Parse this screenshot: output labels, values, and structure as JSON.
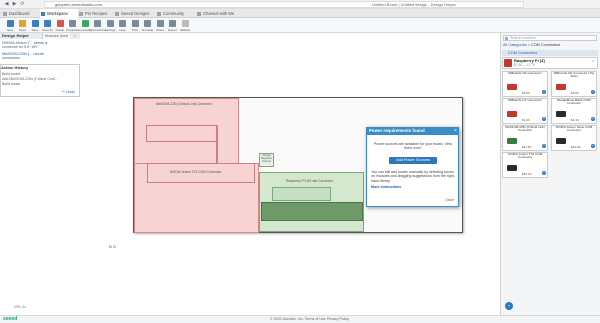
{
  "browser": {
    "url": "geppetto.seeedstudio.com",
    "center_title": "Untitled Board | Untitled design - Design Helper",
    "controls": [
      "←",
      "→",
      "⟳"
    ]
  },
  "tabs": [
    {
      "label": "Dashboard"
    },
    {
      "label": "Workspace"
    },
    {
      "label": "Pin Recipes"
    },
    {
      "label": "Seeed Designs"
    },
    {
      "label": "Community"
    },
    {
      "label": "Channel with Me"
    }
  ],
  "toolbar": [
    {
      "label": "New",
      "color": "#3c7fc0"
    },
    {
      "label": "Open",
      "color": "#e0a22b"
    },
    {
      "label": "Save",
      "color": "#3c7fc0"
    },
    {
      "label": "Save As",
      "color": "#3c7fc0"
    },
    {
      "label": "Delete",
      "color": "#d9534f"
    },
    {
      "label": "Duplicate",
      "color": "#7a8a99"
    },
    {
      "label": "Connector",
      "color": "#3caa5a"
    },
    {
      "label": "Connections",
      "color": "#7a8a99"
    },
    {
      "label": "Settings",
      "color": "#7a8a99"
    },
    {
      "label": "Help",
      "color": "#7a8a99"
    },
    {
      "label": "Print",
      "color": "#7a8a99"
    },
    {
      "label": "Simulate",
      "color": "#7a8a99"
    },
    {
      "label": "Share",
      "color": "#7a8a99"
    },
    {
      "label": "Export",
      "color": "#7a8a99"
    },
    {
      "label": "Validate",
      "color": "#bbbbbb"
    }
  ],
  "design_helper": {
    "title": "Design Helper",
    "tab": "Modules Used",
    "items": [
      {
        "title": "NVIDIA Jetson T... needs a",
        "sub": "connector for 5.5~19V"
      },
      {
        "title": "MiniSOM-225x [... needs",
        "sub": "connectors"
      }
    ]
  },
  "action_history": {
    "title": "Action History",
    "items": [
      "Build board",
      "Add MiniSOM-225x [Critical Coni...",
      "Build board"
    ],
    "undo_label": "↶ Undo"
  },
  "board": {
    "labels": {
      "top_pink": "MiniSOM-225x [Critical Link] Connector",
      "mid_pink": "NVIDIA Jetson TX2 COM Connector",
      "green": "Raspberry Pi HAT-site Connector",
      "small": "Voltage Regulator (Jetson)"
    },
    "scale": "N G"
  },
  "popup": {
    "title": "Power requirements found",
    "text1": "Power sources are available for your board. View them now?",
    "button": "Add Power Sources",
    "text2": "You can still add power manually by selecting boxes on modules and dragging suggestions from the right-hand library.",
    "link": "More instructions",
    "close": "Close"
  },
  "library": {
    "search_placeholder": "Search modules",
    "breadcrumb_all": "All Categories",
    "breadcrumb_current": "COM Connectors",
    "section": "COM Connectors",
    "selected": {
      "title": "Raspberry Pi [4]",
      "sub": "$7.46 — 11.79",
      "chip_color": "#c0392b"
    },
    "cards": [
      {
        "title": "96Boards CE Connector",
        "price": "$6.00",
        "color": "#c0392b"
      },
      {
        "title": "96Boards CE Connector (Top Side)",
        "price": "$6.00",
        "color": "#c0392b"
      },
      {
        "title": "96Boards IoT Connector",
        "price": "$4.26",
        "color": "#c0392b"
      },
      {
        "title": "BeagleBone Black COM Connector",
        "price": "$4.10",
        "color": "#2b2b2b"
      },
      {
        "title": "MiniSOM-225x [Critical Link] Connector",
        "price": "$11.50",
        "color": "#3a7a3a"
      },
      {
        "title": "NVIDIA Jetson Nano COM Connector",
        "price": "$10.00",
        "color": "#2b2b2b"
      },
      {
        "title": "NVIDIA Jetson TX2 COM Connector",
        "price": "$10.00",
        "color": "#2b2b2b"
      }
    ]
  },
  "status": {
    "logo": "seeed",
    "copyright": "© 2020 Gumstix, Inc. Terms of Use Privacy Policy",
    "zoom": "DRC 0x"
  }
}
